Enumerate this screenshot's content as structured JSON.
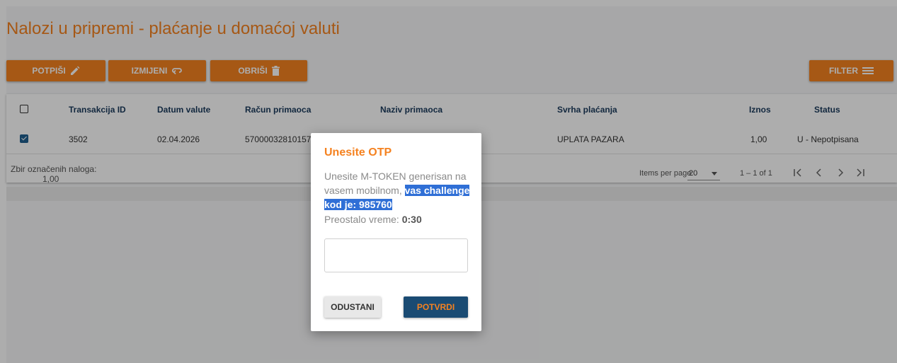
{
  "page": {
    "title": "Nalozi u pripremi - plaćanje u domaćoj valuti"
  },
  "toolbar": {
    "sign_label": "POTPIŠI",
    "edit_label": "IZMIJENI",
    "delete_label": "OBRIŠI",
    "filter_label": "FILTER",
    "accent_color": "#f58220"
  },
  "table": {
    "columns": [
      "Transakcija ID",
      "Datum valute",
      "Račun primaoca",
      "Naziv primaoca",
      "Svrha plaćanja",
      "Iznos",
      "Status"
    ],
    "rows": [
      {
        "checked": true,
        "transaction_id": "3502",
        "value_date": "02.04.2026",
        "recipient_account": "57000032810157",
        "recipient_name": "",
        "payment_purpose": "UPLATA PAZARA",
        "amount": "1,00",
        "status": "U - Nepotpisana"
      }
    ]
  },
  "footer": {
    "selected_sum_label": "Zbir označenih naloga:",
    "selected_sum_value": "1,00",
    "items_per_page_label": "Items per page:",
    "items_per_page_value": "20",
    "range_label": "1 – 1 of 1"
  },
  "dialog": {
    "title": "Unesite OTP",
    "message_plain": "Unesite M-TOKEN generisan na vasem mobilnom, ",
    "message_highlight": "vas challenge kod je: 985760",
    "time_label": "Preostalo vreme: ",
    "time_value": "0:30",
    "otp_value": "",
    "cancel_label": "ODUSTANI",
    "confirm_label": "POTVRDI"
  }
}
